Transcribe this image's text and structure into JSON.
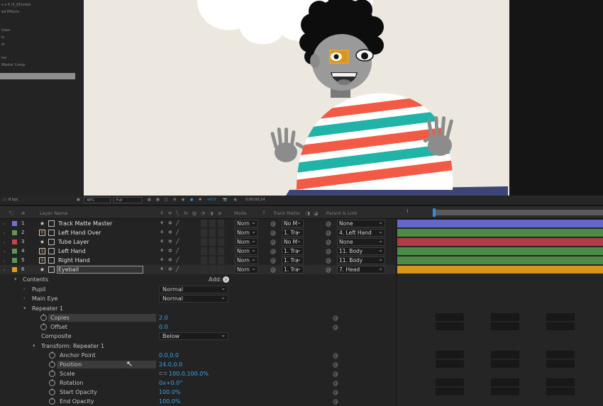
{
  "project_panel": {
    "lines": [
      "s x 6 (0_05)view",
      "ed Effects",
      "lutes",
      "ls",
      "ol",
      "ice",
      "Master Comp"
    ]
  },
  "viewer_bar": {
    "zoom": "48%",
    "resolution": "Full",
    "exposure": "+0.0",
    "timecode": "0;00;00;14",
    "toggle": "8 bpc"
  },
  "timeline_header": {
    "layer_name": "Layer Name",
    "hash": "#",
    "mode": "Mode",
    "t": "T",
    "track_matte": "Track Matte",
    "parent_link": "Parent & Link"
  },
  "layers": [
    {
      "num": "1",
      "name": "Track Matte Master",
      "color": "#6f73d8",
      "type": "star",
      "mode": "Norn",
      "matte": "No M",
      "parent": "None"
    },
    {
      "num": "2",
      "name": "Left Hand Over",
      "color": "#5a9a54",
      "type": "puppet",
      "mode": "Norn",
      "matte": "1. Tra",
      "parent": "4. Left Hand"
    },
    {
      "num": "3",
      "name": "Tube Layer",
      "color": "#c4444a",
      "type": "star",
      "mode": "Norn",
      "matte": "No M",
      "parent": "None"
    },
    {
      "num": "4",
      "name": "Left Hand",
      "color": "#5a9a54",
      "type": "puppet",
      "mode": "Norn",
      "matte": "1. Tra",
      "parent": "11. Body"
    },
    {
      "num": "5",
      "name": "Right Hand",
      "color": "#5a9a54",
      "type": "puppet",
      "mode": "Norn",
      "matte": "1. Tra",
      "parent": "11. Body"
    },
    {
      "num": "6",
      "name": "Eyeball",
      "color": "#e69b1e",
      "type": "star",
      "mode": "Norn",
      "matte": "1. Tra",
      "parent": "7. Head"
    }
  ],
  "track_colors": [
    "#6367c7",
    "#4c8a48",
    "#b23c43",
    "#4c8a48",
    "#4c8a48",
    "#d8951c"
  ],
  "contents": {
    "label": "Contents",
    "add_label": "Add:",
    "pupil": {
      "name": "Pupil",
      "mode": "Normal"
    },
    "main_eye": {
      "name": "Main Eye",
      "mode": "Normal"
    },
    "repeater": {
      "name": "Repeater 1",
      "copies_label": "Copies",
      "copies_value": "2.0",
      "offset_label": "Offset",
      "offset_value": "0.0",
      "composite_label": "Composite",
      "composite_value": "Below",
      "transform": {
        "name": "Transform: Repeater 1",
        "anchor_label": "Anchor Point",
        "anchor_value": "0.0,0.0",
        "position_label": "Position",
        "position_value": "24.0,0.0",
        "scale_label": "Scale",
        "scale_value": "100.0,100.0%",
        "rotation_label": "Rotation",
        "rotation_value": "0x+0.0°",
        "start_opacity_label": "Start Opacity",
        "start_opacity_value": "100.0%",
        "end_opacity_label": "End Opacity",
        "end_opacity_value": "100.0%"
      }
    }
  },
  "colors": {
    "accent_blue": "#3aa0e6",
    "stripe_red": "#f25a45",
    "stripe_teal": "#1fb4a7",
    "canvas": "#ede8df"
  }
}
